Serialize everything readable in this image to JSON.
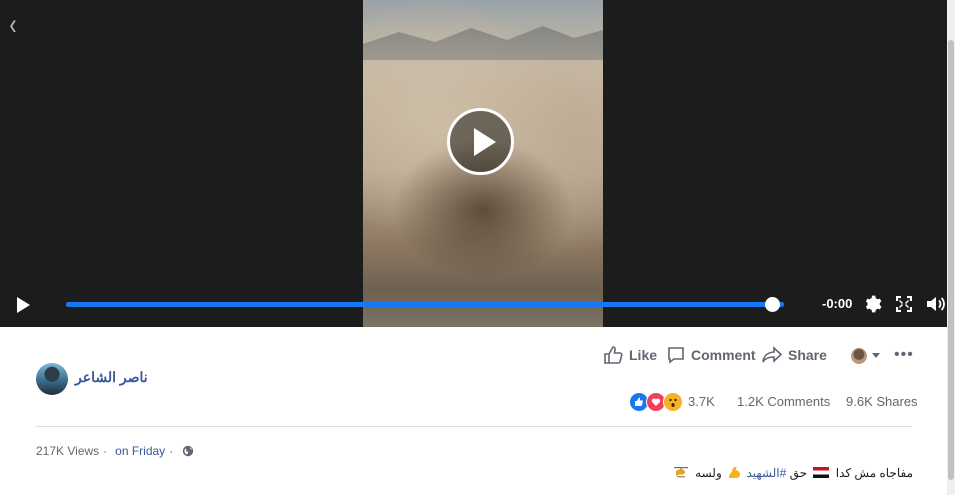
{
  "player": {
    "back_label": "‹",
    "time_remaining": "-0:00",
    "progress": 1.0
  },
  "post": {
    "author": "ناصر الشاعر",
    "actions": {
      "like": "Like",
      "comment": "Comment",
      "share": "Share"
    },
    "reaction_count": "3.7K",
    "comments": "1.2K Comments",
    "shares": "9.6K Shares",
    "views": "217K Views",
    "date": "on Friday",
    "caption": {
      "part1": "مفاجاه مش كدا",
      "part2": "حق",
      "hashtag": "#الشهيد",
      "part3": "ولسه"
    }
  },
  "colors": {
    "accent": "#1877f2",
    "link": "#385898",
    "muted": "#606770"
  },
  "icons": [
    "back-chevron-icon",
    "play-icon",
    "settings-gear-icon",
    "fullscreen-icon",
    "volume-icon",
    "like-icon",
    "comment-icon",
    "share-icon",
    "globe-icon"
  ]
}
